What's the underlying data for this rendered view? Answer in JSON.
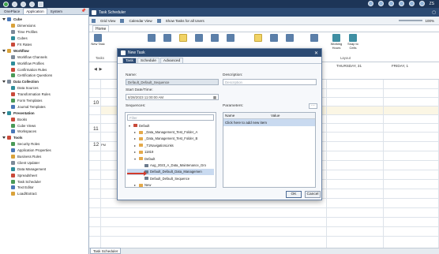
{
  "topbar": {
    "right_label": "ZS"
  },
  "left_panel": {
    "tabs": [
      "OnePlace",
      "Application",
      "System"
    ],
    "active_tab": "Application",
    "sections": [
      {
        "label": "Cube",
        "items": [
          "Dimensions",
          "Time Profiles",
          "Cubes",
          "FX Rates"
        ]
      },
      {
        "label": "Workflow",
        "items": [
          "Workflow Channels",
          "Workflow Profiles",
          "Confirmation Rules",
          "Certification Questions"
        ]
      },
      {
        "label": "Data Collection",
        "items": [
          "Data Sources",
          "Transformation Rules",
          "Form Templates",
          "Journal Templates"
        ]
      },
      {
        "label": "Presentation",
        "items": [
          "Books",
          "Cube Views",
          "Workspaces"
        ]
      },
      {
        "label": "Tools",
        "items": [
          "Security Roles",
          "Application Properties",
          "Business Rules",
          "Client Updater",
          "Data Management",
          "Spreadsheet",
          "Task Scheduler",
          "Text Editor",
          "Load/Extract"
        ]
      }
    ]
  },
  "main": {
    "title": "Task Scheduler",
    "toolbar": {
      "grid_view": "Grid View",
      "calendar_view": "Calendar View",
      "show_tasks": "Show Tasks for all Users",
      "zoom": "100%"
    },
    "ribbon_tab": "Home",
    "ribbon": {
      "new_task": "New Task",
      "tasks_group": "Tasks",
      "working_hours": "Working Hours",
      "snap_to_cells": "Snap to Cells",
      "layout_group": "Layout"
    },
    "calendar": {
      "days": [
        "THURSDAY, 31",
        "FRIDAY, 1"
      ],
      "hours": [
        "10",
        "11",
        "12"
      ],
      "hour_suffix": "PM"
    },
    "bottom_tab": "Task Scheduler"
  },
  "dialog": {
    "title": "New Task",
    "tabs": [
      "Task",
      "Schedule",
      "Advanced"
    ],
    "active_tab": "Task",
    "name_label": "Name:",
    "name_value": "Default_Default_Sequence",
    "description_label": "Description:",
    "description_placeholder": "Description",
    "start_label": "Start Date/Time:",
    "start_value": "8/28/2023 11:00:00 AM",
    "sequences_label": "Sequences:",
    "filter_placeholder": "Filter",
    "sequences": [
      {
        "label": "Default",
        "level": 0,
        "kind": "folder-red"
      },
      {
        "label": "_Data_Management_Test_Folder_A",
        "level": 1,
        "kind": "folder"
      },
      {
        "label": "_Data_Management_Test_Folder_B",
        "level": 1,
        "kind": "folder"
      },
      {
        "label": "_T1NavigationLinks",
        "level": 1,
        "kind": "folder"
      },
      {
        "label": "11819",
        "level": 1,
        "kind": "folder"
      },
      {
        "label": "Default",
        "level": 1,
        "kind": "folder"
      },
      {
        "label": "Aug_2023_A_Data_Maintenance_Gro",
        "level": 2,
        "kind": "seq"
      },
      {
        "label": "Default_Default_Data_Managemen",
        "level": 2,
        "kind": "seq",
        "selected": true
      },
      {
        "label": "Default_Default_Sequence",
        "level": 2,
        "kind": "seq"
      },
      {
        "label": "New",
        "level": 1,
        "kind": "folder"
      }
    ],
    "parameters_label": "Parameters:",
    "param_columns": [
      "Name",
      "Value"
    ],
    "param_add": "Click here to add new item",
    "ok": "OK",
    "cancel": "Cancel"
  }
}
